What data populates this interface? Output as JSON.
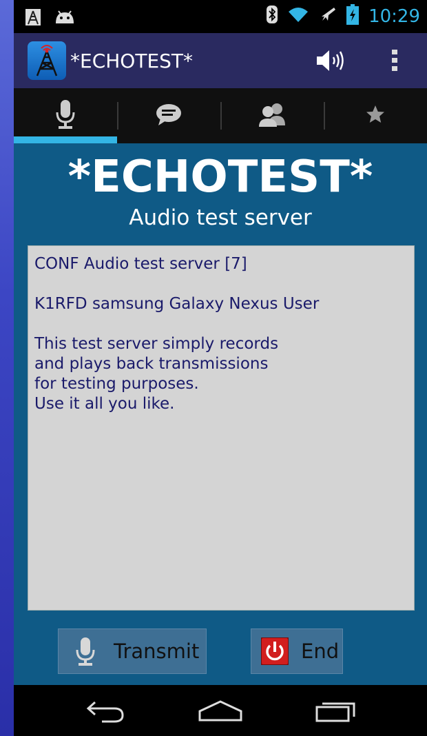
{
  "status_bar": {
    "time": "10:29",
    "left_icons": [
      "signal-tower-notification-icon",
      "android-icon"
    ],
    "right_icons": [
      "bluetooth-icon",
      "wifi-icon",
      "airplane-mode-icon",
      "battery-charging-icon"
    ]
  },
  "action_bar": {
    "title": "*ECHOTEST*",
    "app_icon": "radio-tower-icon",
    "speaker_icon": "speaker-volume-icon",
    "overflow_icon": "overflow-menu-icon"
  },
  "tabs": [
    {
      "icon": "microphone-icon",
      "selected": true
    },
    {
      "icon": "chat-bubble-icon",
      "selected": false
    },
    {
      "icon": "people-icon",
      "selected": false
    },
    {
      "icon": "star-icon",
      "selected": false
    }
  ],
  "station": {
    "name": "*ECHOTEST*",
    "description": "Audio test server"
  },
  "info_lines": [
    "CONF Audio test server [7]",
    "K1RFD samsung Galaxy Nexus User",
    "This test server simply records\nand plays back transmissions\nfor testing purposes.\nUse it all you like."
  ],
  "buttons": {
    "transmit_label": "Transmit",
    "end_label": "End"
  },
  "nav_bar": {
    "icons": [
      "back-icon",
      "home-icon",
      "recent-apps-icon"
    ]
  },
  "colors": {
    "accent": "#33b5e5",
    "content_bg": "#0f5a86",
    "info_text": "#1a1a6a",
    "end_red": "#d21e1e"
  }
}
